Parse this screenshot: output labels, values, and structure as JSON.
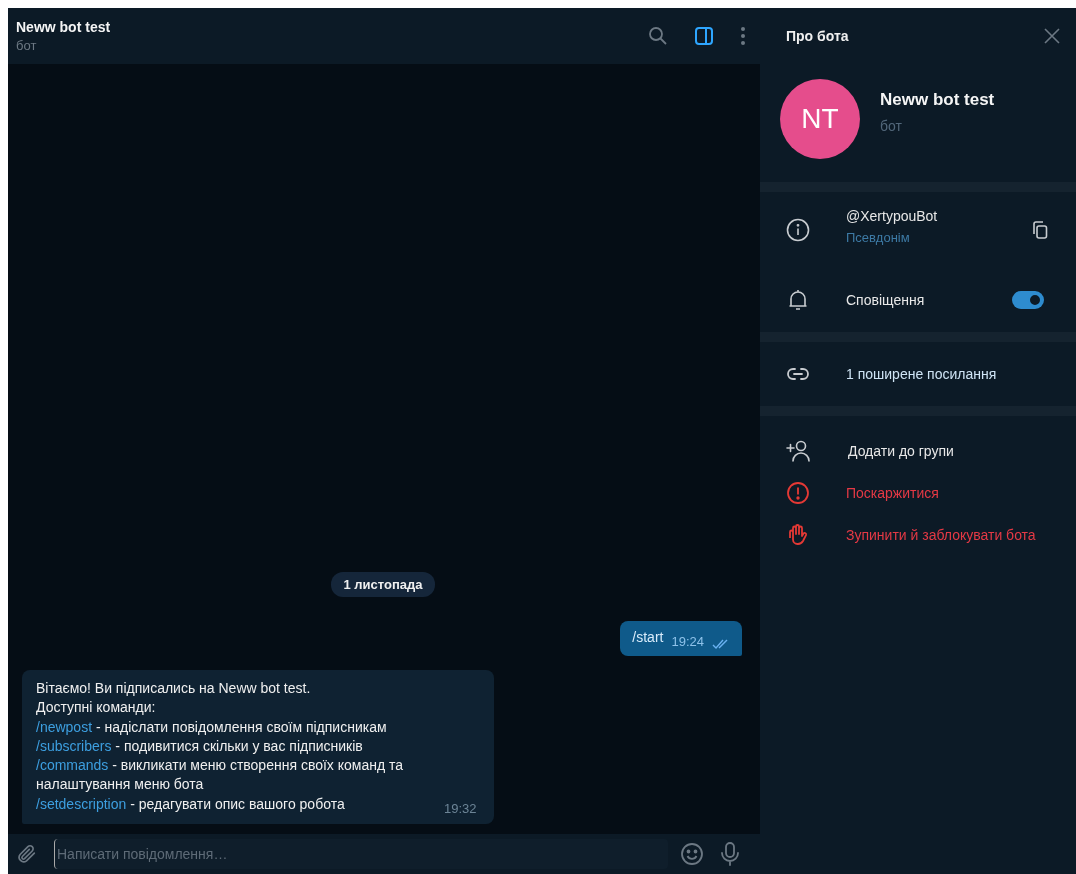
{
  "chat_header": {
    "title": "Neww bot test",
    "subtitle": "бот",
    "info_panel_open": true
  },
  "messages": [
    {
      "kind": "date",
      "text": "1 листопада"
    },
    {
      "kind": "outgoing",
      "text": "/start",
      "time": "19:24",
      "read": true
    },
    {
      "kind": "incoming",
      "lines": [
        {
          "text": "Вітаємо! Ви підписались на Neww bot test."
        },
        {
          "text": "Доступні команди:"
        },
        {
          "command": "/newpost",
          "text": " - надіслати повідомлення своїм підписникам"
        },
        {
          "command": "/subscribers",
          "text": " - подивитися скільки у вас  підписників"
        },
        {
          "command": "/commands",
          "text": " - викликати меню створення своїх команд та налаштування меню бота"
        },
        {
          "command": "/setdescription",
          "text": " - редагувати опис вашого робота"
        }
      ],
      "time": "19:32"
    }
  ],
  "composer": {
    "placeholder": "Написати повідомлення…"
  },
  "info_panel": {
    "title": "Про бота",
    "profile": {
      "initials": "NT",
      "name": "Neww bot test",
      "subtitle": "бот"
    },
    "username": {
      "value": "@XertypouBot",
      "label": "Псевдонім"
    },
    "notifications": {
      "label": "Сповіщення",
      "on": true
    },
    "shared_links": {
      "text": "1 поширене посилання"
    },
    "actions": [
      {
        "kind": "add",
        "label": "Додати до групи"
      },
      {
        "kind": "report",
        "label": "Поскаржитися"
      },
      {
        "kind": "block",
        "label": "Зупинити й заблокувати бота"
      }
    ]
  }
}
